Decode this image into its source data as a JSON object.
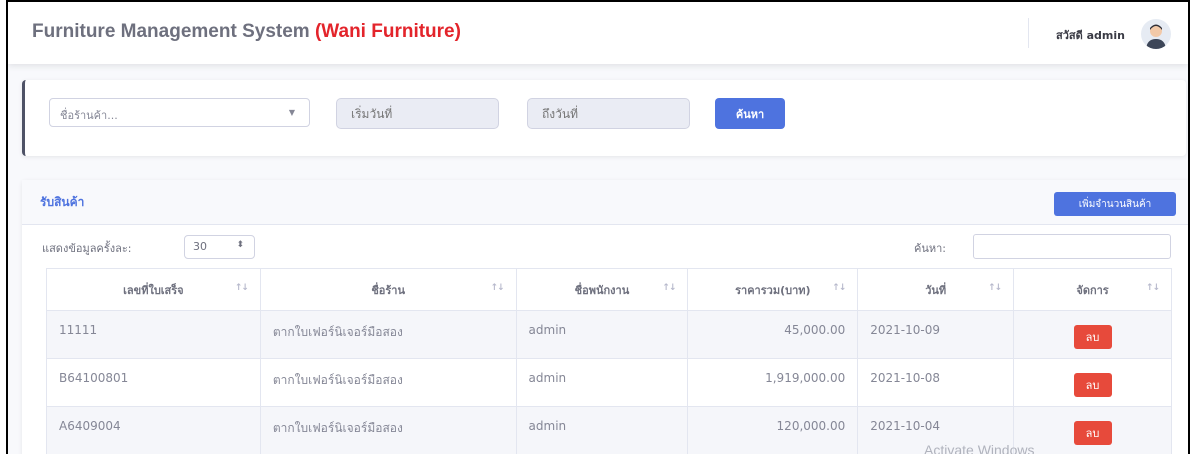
{
  "header": {
    "app_title": "Furniture Management System",
    "brand": "(Wani Furniture)",
    "greeting": "สวัสดี admin"
  },
  "filter": {
    "shop_placeholder": "ชื่อร้านค้า...",
    "start_date_placeholder": "เริ่มวันที่",
    "end_date_placeholder": "ถึงวันที่",
    "search_label": "ค้นหา"
  },
  "card": {
    "title": "รับสินค้า",
    "add_button": "เพิ่มจำนวนสินค้า"
  },
  "table_controls": {
    "length_label": "แสดงข้อมูลครั้งละ:",
    "length_value": "30",
    "search_label": "ค้นหา:"
  },
  "table": {
    "headers": [
      "เลขที่ใบเสร็จ",
      "ชื่อร้าน",
      "ชื่อพนักงาน",
      "ราคารวม(บาท)",
      "วันที่",
      "จัดการ"
    ],
    "rows": [
      {
        "receipt": "11111",
        "shop": "ตากใบเฟอร์นิเจอร์มือสอง",
        "employee": "admin",
        "total": "45,000.00",
        "date": "2021-10-09",
        "action": "ลบ"
      },
      {
        "receipt": "B64100801",
        "shop": "ตากใบเฟอร์นิเจอร์มือสอง",
        "employee": "admin",
        "total": "1,919,000.00",
        "date": "2021-10-08",
        "action": "ลบ"
      },
      {
        "receipt": "A6409004",
        "shop": "ตากใบเฟอร์นิเจอร์มือสอง",
        "employee": "admin",
        "total": "120,000.00",
        "date": "2021-10-04",
        "action": "ลบ"
      }
    ]
  },
  "watermark": "Activate Windows",
  "icons": {
    "sort": "sort-arrows-icon",
    "caret": "caret-down-icon",
    "avatar": "user-avatar-icon"
  },
  "colors": {
    "primary": "#4e73df",
    "brand_red": "#e3242b",
    "danger": "#e74a3b"
  }
}
